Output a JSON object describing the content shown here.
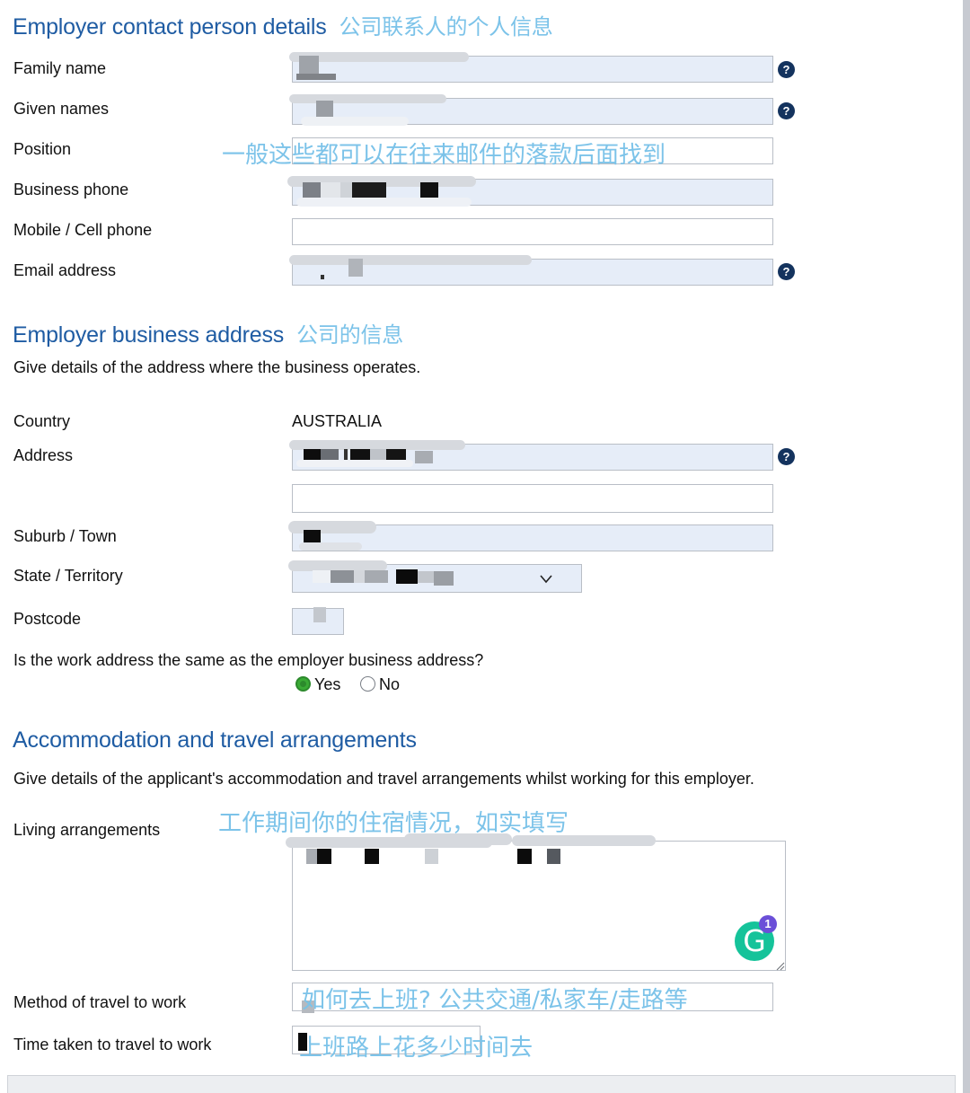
{
  "colors": {
    "heading_blue": "#1f5ca3",
    "annotation_cyan": "#7cc3e9",
    "field_fill": "#e6edf8",
    "field_border": "#b9bec6",
    "help_navy": "#14335e",
    "radio_green": "#3aaa35",
    "grammarly_green": "#15c39a",
    "grammarly_badge_purple": "#6b4fd8"
  },
  "sections": {
    "contact": {
      "title": "Employer contact person details",
      "annotation": "公司联系人的个人信息",
      "fields": [
        {
          "label": "Family name",
          "value": "",
          "help": true,
          "filled": true,
          "redacted": true
        },
        {
          "label": "Given names",
          "value": "",
          "help": true,
          "filled": true,
          "redacted": true
        },
        {
          "label": "Position",
          "value": "",
          "help": false,
          "filled": false,
          "redacted": false,
          "annotation": "一般这些都可以在往来邮件的落款后面找到"
        },
        {
          "label": "Business phone",
          "value": "",
          "help": false,
          "filled": true,
          "redacted": true
        },
        {
          "label": "Mobile / Cell phone",
          "value": "",
          "help": false,
          "filled": false,
          "redacted": false
        },
        {
          "label": "Email address",
          "value": "",
          "help": true,
          "filled": true,
          "redacted": true
        }
      ]
    },
    "business_address": {
      "title": "Employer business address",
      "annotation": "公司的信息",
      "subtitle": "Give details of the address where the business operates.",
      "country_label": "Country",
      "country_value": "AUSTRALIA",
      "address_label": "Address",
      "address_line2_label": "",
      "suburb_label": "Suburb / Town",
      "state_label": "State / Territory",
      "postcode_label": "Postcode",
      "question": "Is the work address the same as the employer business address?",
      "options": [
        {
          "label": "Yes",
          "selected": true
        },
        {
          "label": "No",
          "selected": false
        }
      ]
    },
    "accommodation": {
      "title": "Accommodation and travel arrangements",
      "subtitle": "Give details of the applicant's accommodation and travel arrangements whilst working for this employer.",
      "living_label": "Living arrangements",
      "living_annotation": "工作期间你的住宿情况，如实填写",
      "method_label": "Method of travel to work",
      "method_annotation": "如何去上班? 公共交通/私家车/走路等",
      "time_label": "Time taken to travel to work",
      "time_annotation": "上班路上花多少时间去"
    }
  },
  "icons": {
    "help": "?",
    "grammarly_letter": "G",
    "grammarly_count": "1"
  }
}
